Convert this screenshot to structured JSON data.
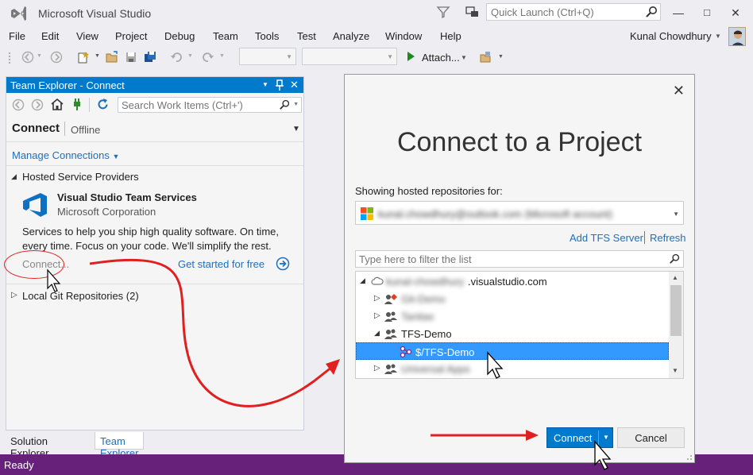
{
  "window": {
    "title": "Microsoft Visual Studio",
    "user": "Kunal Chowdhury"
  },
  "quick_launch": {
    "placeholder": "Quick Launch (Ctrl+Q)"
  },
  "menu": [
    "File",
    "Edit",
    "View",
    "Project",
    "Debug",
    "Team",
    "Tools",
    "Test",
    "Analyze",
    "Window",
    "Help"
  ],
  "toolbar": {
    "attach_label": "Attach..."
  },
  "team_explorer": {
    "title": "Team Explorer - Connect",
    "search_placeholder": "Search Work Items (Ctrl+')",
    "page": "Connect",
    "status": "Offline",
    "manage_connections": "Manage Connections",
    "hosted_section": "Hosted Service Providers",
    "service_name": "Visual Studio Team Services",
    "service_corp": "Microsoft Corporation",
    "service_desc": "Services to help you ship high quality software. On time, every time. Focus on your code. We'll simplify the rest.",
    "connect_link": "Connect...",
    "get_started": "Get started for free",
    "local_git": "Local Git Repositories (2)"
  },
  "bottom_tabs": [
    "Solution Explorer",
    "Team Explorer"
  ],
  "status_bar": {
    "text": "Ready",
    "color": "#68217a"
  },
  "dialog": {
    "title": "Connect to a Project",
    "showing_label": "Showing hosted repositories for:",
    "account": "kunal.chowdhury@outlook.com (Microsoft account)",
    "add_tfs": "Add TFS Server",
    "refresh": "Refresh",
    "filter_placeholder": "Type here to filter the list",
    "tree": {
      "server_blurred": "kunal-chowdhury",
      "server_suffix": ".visualstudio.com",
      "items": [
        {
          "label": "Git-Demo",
          "blurred": true
        },
        {
          "label": "Tanitas",
          "blurred": true
        },
        {
          "label": "TFS-Demo",
          "blurred": false
        },
        {
          "label": "$/TFS-Demo",
          "blurred": false,
          "selected": true
        },
        {
          "label": "Universal Apps",
          "blurred": true
        }
      ]
    },
    "connect_button": "Connect",
    "cancel_button": "Cancel"
  },
  "colors": {
    "accent": "#007acc",
    "annotation": "#e02020",
    "selection": "#3399ff"
  }
}
